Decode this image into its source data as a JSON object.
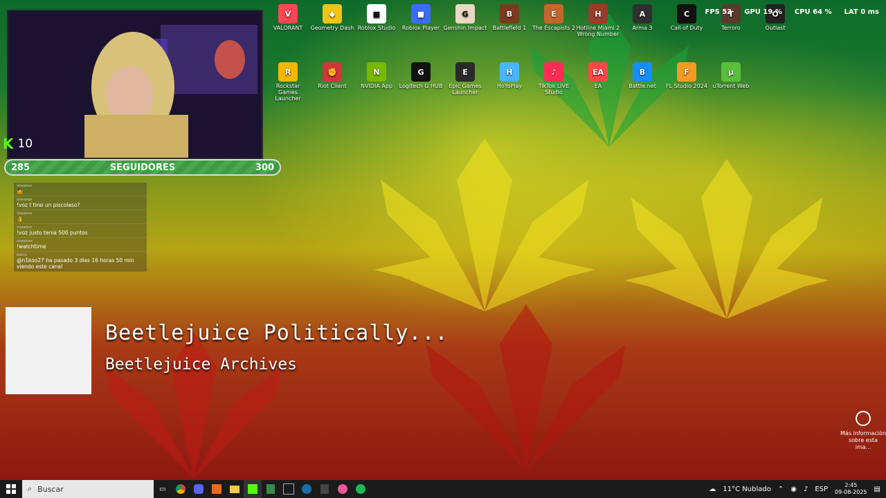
{
  "webcam": {
    "kick_count": "10"
  },
  "followers": {
    "current": "285",
    "label": "SEGUIDORES",
    "goal": "300"
  },
  "chat": [
    {
      "user": "streamer",
      "text": "🤷"
    },
    {
      "user": "streamer",
      "text": "!voz t tirai un piscolaso?"
    },
    {
      "user": "streamer",
      "text": "👌"
    },
    {
      "user": "streamer",
      "text": "!voz justo tenia 500 puntos"
    },
    {
      "user": "streamer",
      "text": "!watchtime"
    },
    {
      "user": "botrix",
      "text": "@n1koo27 ha pasado 3 dias 16 horas 50 min viendo este canal"
    }
  ],
  "music": {
    "title": "Beetlejuice Politically...",
    "artist": "Beetlejuice Archives"
  },
  "stats": {
    "fps_label": "FPS",
    "fps": "52",
    "gpu_label": "GPU",
    "gpu": "19 %",
    "cpu_label": "CPU",
    "cpu": "64 %",
    "lat_label": "LAT",
    "lat": "0 ms"
  },
  "desktop_icons_row1": [
    {
      "name": "VALORANT",
      "color": "#ff4655",
      "glyph": "V"
    },
    {
      "name": "Geometry Dash",
      "color": "#f3c315",
      "glyph": "◆"
    },
    {
      "name": "Roblox Studio",
      "color": "#ffffff",
      "glyph": "■"
    },
    {
      "name": "Roblox Player",
      "color": "#3b6cf6",
      "glyph": "■"
    },
    {
      "name": "Genshin Impact",
      "color": "#e8d8c4",
      "glyph": "G"
    },
    {
      "name": "Battlefield 1",
      "color": "#7a3a1e",
      "glyph": "B"
    },
    {
      "name": "The Escapists 2",
      "color": "#c4662a",
      "glyph": "E"
    },
    {
      "name": "Hotline Miami 2 Wrong Number",
      "color": "#9b3b2a",
      "glyph": "H"
    },
    {
      "name": "Arma 3",
      "color": "#303030",
      "glyph": "A"
    },
    {
      "name": "Call of Duty",
      "color": "#111111",
      "glyph": "C"
    },
    {
      "name": "Terroro",
      "color": "#5a3a2a",
      "glyph": "T"
    },
    {
      "name": "Outlast",
      "color": "#222222",
      "glyph": "O"
    }
  ],
  "desktop_icons_row2": [
    {
      "name": "Rockstar Games Launcher",
      "color": "#f5b700",
      "glyph": "R"
    },
    {
      "name": "Riot Client",
      "color": "#d13639",
      "glyph": "✊"
    },
    {
      "name": "NVIDIA App",
      "color": "#76b900",
      "glyph": "N"
    },
    {
      "name": "Logitech G HUB",
      "color": "#111111",
      "glyph": "G"
    },
    {
      "name": "Epic Games Launcher",
      "color": "#2a2a2a",
      "glyph": "E"
    },
    {
      "name": "HoYoPlay",
      "color": "#47b6ff",
      "glyph": "H"
    },
    {
      "name": "TikTok LIVE Studio",
      "color": "#fe2c55",
      "glyph": "♪"
    },
    {
      "name": "EA",
      "color": "#ff4747",
      "glyph": "EA"
    },
    {
      "name": "Battle.net",
      "color": "#148eff",
      "glyph": "B"
    },
    {
      "name": "FL Studio 2024",
      "color": "#f79a1e",
      "glyph": "F"
    },
    {
      "name": "uTorrent Web",
      "color": "#5bbf3b",
      "glyph": "µ"
    }
  ],
  "info": {
    "text": "Más información sobre esta ima..."
  },
  "taskbar": {
    "search_placeholder": "Buscar",
    "weather": "11°C  Nublado",
    "lang": "ESP",
    "time": "2:45",
    "date": "09-08-2025"
  }
}
